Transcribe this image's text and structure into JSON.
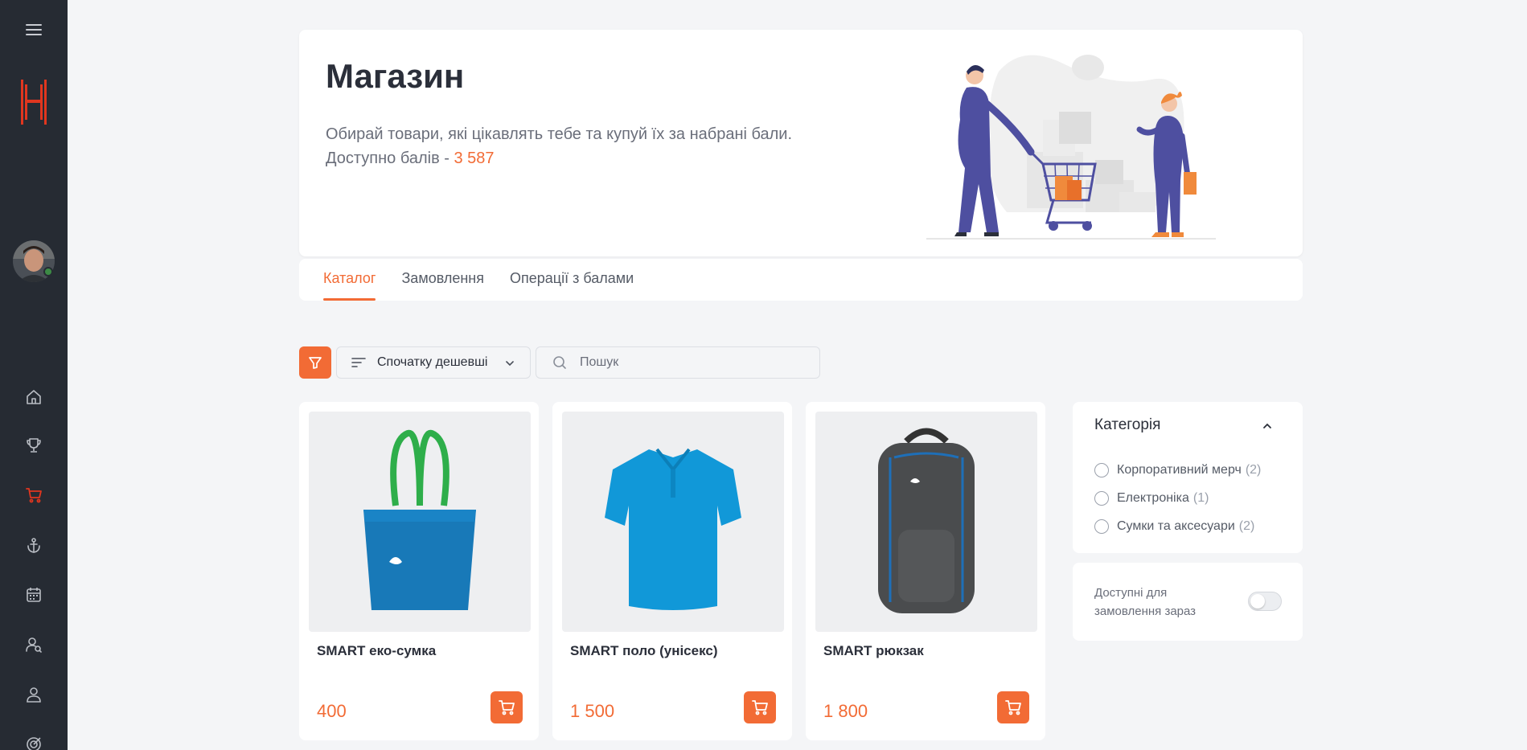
{
  "colors": {
    "accent": "#f26b35",
    "sidebar": "#262b33",
    "background": "#f4f5f7"
  },
  "sidebar": {
    "menu_icon": "hamburger-icon",
    "logo_icon": "brand-logo-icon",
    "items": [
      {
        "icon": "home-icon",
        "active": false
      },
      {
        "icon": "trophy-icon",
        "active": false
      },
      {
        "icon": "cart-icon",
        "active": true
      },
      {
        "icon": "anchor-icon",
        "active": false
      },
      {
        "icon": "calendar-icon",
        "active": false
      },
      {
        "icon": "people-search-icon",
        "active": false
      },
      {
        "icon": "user-icon",
        "active": false
      },
      {
        "icon": "target-icon",
        "active": false
      }
    ]
  },
  "hero": {
    "title": "Магазин",
    "description": "Обирай товари, які цікавлять тебе та купуй їх за набрані бали.",
    "points_prefix": "Доступно балів - ",
    "points_value": "3 587"
  },
  "tabs": [
    {
      "label": "Каталог",
      "active": true
    },
    {
      "label": "Замовлення",
      "active": false
    },
    {
      "label": "Операції з балами",
      "active": false
    }
  ],
  "toolbar": {
    "sort_label": "Спочатку дешевші",
    "search_placeholder": "Пошук"
  },
  "products": [
    {
      "name": "SMART еко-сумка",
      "price": "400"
    },
    {
      "name": "SMART поло (унісекс)",
      "price": "1 500"
    },
    {
      "name": "SMART рюкзак",
      "price": "1 800"
    }
  ],
  "filters": {
    "category_title": "Категорія",
    "categories": [
      {
        "label": "Корпоративний мерч",
        "count": "(2)"
      },
      {
        "label": "Електроніка",
        "count": "(1)"
      },
      {
        "label": "Сумки та аксесуари",
        "count": "(2)"
      }
    ],
    "available_label": "Доступні для замовлення зараз",
    "available_on": false
  }
}
